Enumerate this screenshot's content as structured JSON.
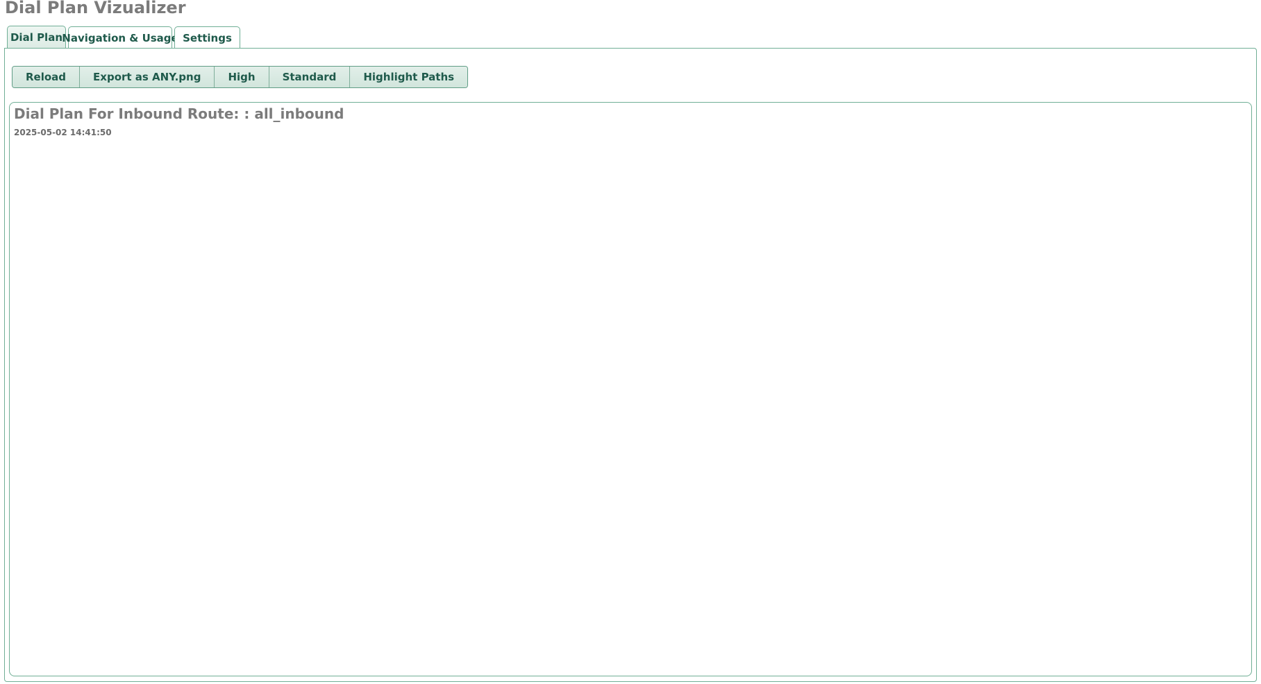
{
  "app": {
    "title": "Dial Plan Vizualizer"
  },
  "tabs": [
    {
      "label": "Dial Plan",
      "active": true
    },
    {
      "label": "Navigation & Usage",
      "active": false
    },
    {
      "label": "Settings",
      "active": false
    }
  ],
  "toolbar": {
    "buttons": [
      {
        "label": "Reload"
      },
      {
        "label": "Export as ANY.png"
      },
      {
        "label": "High"
      },
      {
        "label": "Standard"
      },
      {
        "label": "Highlight Paths"
      }
    ]
  },
  "diagram": {
    "title": "Dial Plan For Inbound Route: : all_inbound",
    "timestamp": "2025-05-02 14:41:50"
  },
  "colors": {
    "accent": "#6fae95",
    "button_text": "#1f5a4b",
    "title_gray": "#7b7b7b"
  }
}
